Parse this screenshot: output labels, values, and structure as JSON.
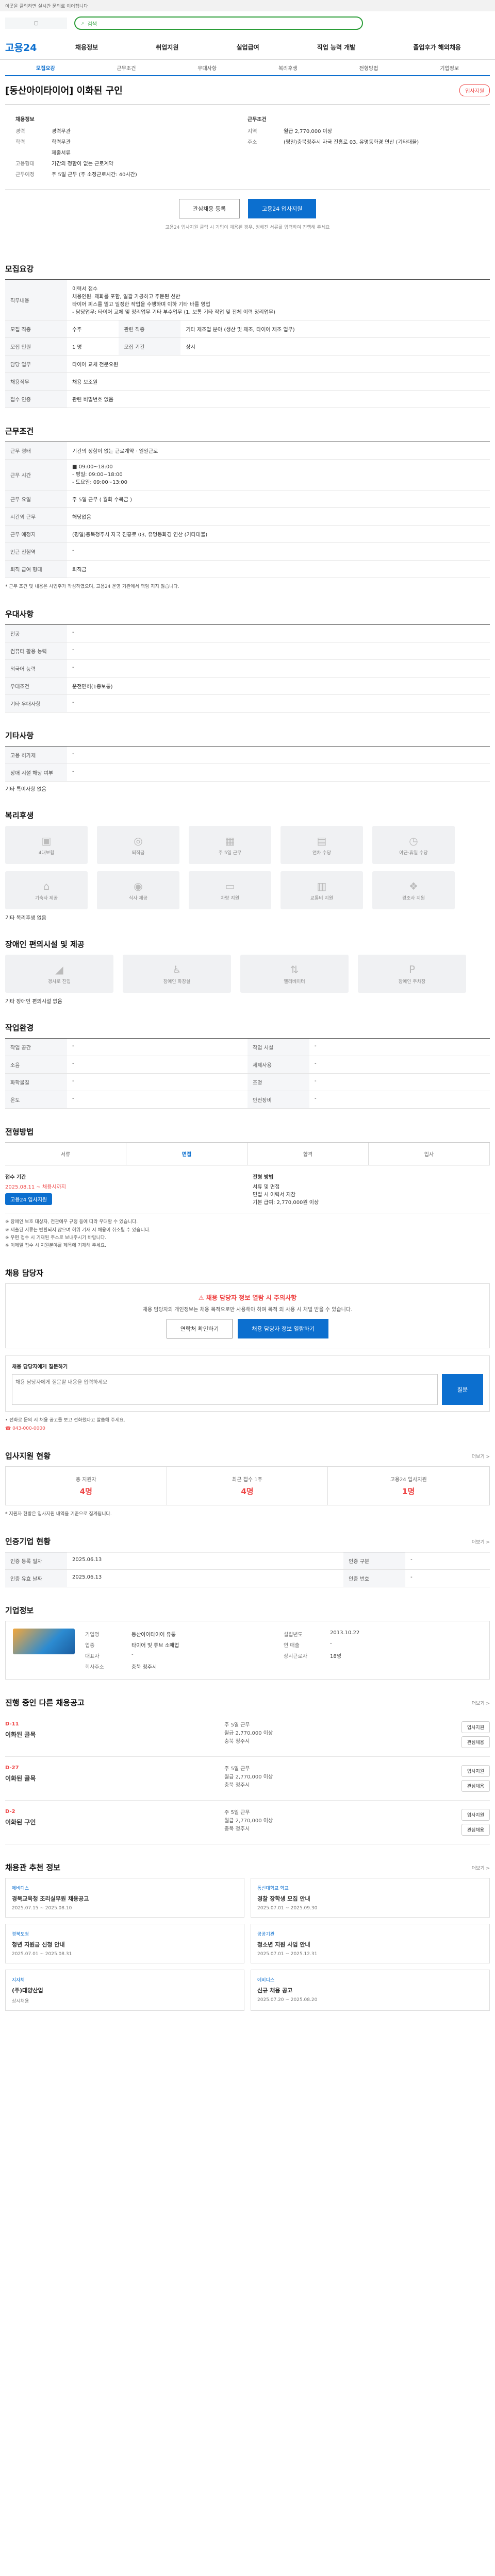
{
  "topbar": "이곳을 클릭하면 실시간 문의로 이어집니다",
  "search_placeholder": "검색",
  "gnb": {
    "brand": "고용24",
    "items": [
      "채용정보",
      "취업지원",
      "실업급여",
      "직업 능력 개발",
      "졸업후가 해외채용"
    ]
  },
  "subtabs": [
    "모집요강",
    "근무조건",
    "우대사항",
    "복리후생",
    "전형방법",
    "기업정보"
  ],
  "job": {
    "title": "[동산아이타이어] 이화된 구인",
    "enter": "입사지원",
    "summary_left": [
      [
        "경력",
        "경력무관"
      ],
      [
        "학력",
        "학력무관"
      ],
      [
        "",
        "제출서류"
      ],
      [
        "고용형태",
        "기간의 정함이 없는 근로계약"
      ],
      [
        "근무예정",
        "주 5일 근무 (주 소정근로시간: 40시간)"
      ]
    ],
    "summary_right": [
      [
        "지역",
        "월급 2,770,000 이상"
      ],
      [
        "주소",
        "(평일)충북청주시 자국 진흥로 03, 유명동화경 연산 (기타대불)"
      ]
    ],
    "summary_right_head": "근무조건",
    "apply_info_head": "채용정보"
  },
  "actions": {
    "interest": "관심채용 등록",
    "apply": "고용24 입사지원"
  },
  "actions_note": "고용24 입사지원 클릭 시 기업이 채용된 경우, 정해진 서류를 입력하여 진행해 주세요",
  "s1": {
    "title": "모집요강",
    "rows": [
      [
        "직무내용",
        "이력서 접수\n채용인원: 제화를 포함, 일괄 가공하고 주문된 선반\n타이어 피스를 밀고 일정한 작업을 수행하며 이하 기타 바를 영업\n- 담당업무: 타이어 교체 및 정리업무 기타 부수업무 (1. 보통 기타 작업 및 전체 이력 정리업무)"
      ],
      [
        "모집 직종",
        "수주"
      ],
      [
        "관련 직종",
        "기타 제조업 분야 (생산 및 제조, 타이어 제조 업무)"
      ],
      [
        "모집 인원",
        "1 명"
      ],
      [
        "모집 기간",
        "상시"
      ],
      [
        "담당 업무",
        "타이어 교체 전문요원"
      ],
      [
        "채용직무",
        "채용 보조원"
      ],
      [
        "접수 인증",
        "관련 비밀번호 없음"
      ]
    ]
  },
  "s2": {
    "title": "근무조건",
    "rows": [
      [
        "근무 형태",
        "기간의 정함이 없는 근로계약 · 일일근로"
      ],
      [
        "근무 시간",
        "■ 09:00~18:00\n- 평일: 09:00~18:00\n- 토요일: 09:00~13:00"
      ],
      [
        "근무 요일",
        "주 5일 근무 ( 월화 수목금 )"
      ],
      [
        "시간외 근무",
        "해당없음"
      ],
      [
        "근무 예정지",
        "(평일)충북청주시 자국 진흥로 03, 유명동화경 연산 (기타대불)"
      ],
      [
        "인근 전철역",
        "-"
      ],
      [
        "퇴직 급여 형태",
        "퇴직금"
      ]
    ]
  },
  "s2_note": "* 근무 조건 및 내용은 사업주가 작성하였으며, 고용24 운영 기관에서 책임 지지 않습니다.",
  "s3": {
    "title": "우대사항",
    "rows": [
      [
        "전공",
        "-"
      ],
      [
        "컴퓨터 활용 능력",
        "-"
      ],
      [
        "외국어 능력",
        "-"
      ],
      [
        "우대조건",
        "운전면허(1종보통)"
      ],
      [
        "기타 우대사항",
        "-"
      ]
    ]
  },
  "s4": {
    "title": "기타사항",
    "rows": [
      [
        "고용 허가제",
        "-"
      ],
      [
        "장애 시설 해당 여부",
        "-"
      ]
    ]
  },
  "s4_extra": "기타 특이사항 없음",
  "s5": {
    "title": "복리후생",
    "items": [
      "4대보험",
      "퇴직금",
      "주 5일 근무",
      "연차 수당",
      "야근·휴일 수당",
      "기숙사 제공",
      "식사 제공",
      "차량 지원",
      "교통비 지원",
      "경조사 지원"
    ]
  },
  "s5_extra": "기타 복리후생 없음",
  "s6": {
    "title": "장애인 편의시설 및 제공",
    "items": [
      "경사로 진입",
      "장애인 화장실",
      "엘리베이터",
      "장애인 주차장"
    ]
  },
  "s6_extra": "기타 장애인 편의시설 없음",
  "s7": {
    "title": "작업환경",
    "rows": [
      [
        "작업 공간",
        "-",
        "작업 시설",
        "-"
      ],
      [
        "소음",
        "-",
        "세제사용",
        "-"
      ],
      [
        "화학물질",
        "-",
        "조명",
        "-"
      ],
      [
        "온도",
        "-",
        "안전장비",
        "-"
      ]
    ]
  },
  "s8": {
    "title": "전형방법",
    "steps": [
      "서류",
      "면접",
      "합격",
      "입사"
    ],
    "a1_lbl": "접수 기간",
    "a1_val": "2025.08.11 ~ 채용시까지",
    "a1_btn": "고용24 입사지원",
    "a2_lbl": "전형 방법",
    "a2_val": "서류 및 면접\n면접 시 이력서 지참\n기본 급여: 2,770,000원 이상",
    "notes": [
      "※ 장애인 보호 대상자, 전관예우 규정 등에 따라 우대할 수 있습니다.",
      "※ 제출된 서류는 반환되지 않으며 허위 기재 시 채용이 취소될 수 있습니다.",
      "※ 우편 접수 시 기재된 주소로 보내주시기 바랍니다.",
      "※ 이메일 접수 시 지원분야를 제목에 기재해 주세요."
    ]
  },
  "s9": {
    "title": "채용 담당자",
    "warn": "채용 담당자 정보 열람 시 주의사항",
    "desc": "채용 담당자의 개인정보는 채용 목적으로만 사용해야 하며 목적 외 사용 시 처벌 받을 수 있습니다.",
    "b1": "연락처 확인하기",
    "b2": "채용 담당자 정보 열람하기",
    "q_label": "채용 담당자에게 질문하기",
    "q_placeholder": "채용 담당자에게 질문할 내용을 입력하세요",
    "q_btn": "질문",
    "phone": "☎ 043-000-0000",
    "contact_note": "• 전화로 문의 시 채용 공고를 보고 전화했다고 말씀해 주세요."
  },
  "s10": {
    "title": "입사지원 현황",
    "more": "더보기 >",
    "stats": [
      [
        "총 지원자",
        "4명"
      ],
      [
        "최근 접수 1주",
        "4명"
      ],
      [
        "고용24 입사지원",
        "1명"
      ]
    ],
    "note": "* 지원자 현황은 입사지원 내역을 기준으로 집계됩니다."
  },
  "s11": {
    "title": "인증기업 현황",
    "more": "더보기 >",
    "rows": [
      [
        "인증 등록 일자",
        "2025.06.13",
        "인증 구분",
        "-"
      ],
      [
        "인증 유효 날짜",
        "2025.06.13",
        "인증 번호",
        "-"
      ]
    ]
  },
  "s12": {
    "title": "기업정보",
    "rows": [
      [
        "기업명",
        "동산아이타이어 유통",
        "설립년도",
        "2013.10.22"
      ],
      [
        "업종",
        "타이어 및 튜브 소매업",
        "연 매출",
        "-"
      ],
      [
        "대표자",
        "-",
        "상시근로자",
        "18명"
      ],
      [
        "회사주소",
        "충북 청주시",
        "",
        ""
      ]
    ]
  },
  "s13": {
    "title": "진행 중인 다른 채용공고",
    "more": "더보기 >",
    "jobs": [
      {
        "d": "D-11",
        "t": "이화된 골목",
        "m": "주 5일 근무\n월급 2,770,000 이상\n충북 청주시",
        "b": [
          "입사지원",
          "관심채용"
        ]
      },
      {
        "d": "D-27",
        "t": "이화된 골목",
        "m": "주 5일 근무\n월급 2,770,000 이상\n충북 청주시",
        "b": [
          "입사지원",
          "관심채용"
        ]
      },
      {
        "d": "D-2",
        "t": "이화된 구인",
        "m": "주 5일 근무\n월급 2,770,000 이상\n충북 청주시",
        "b": [
          "입사지원",
          "관심채용"
        ]
      }
    ]
  },
  "s14": {
    "title": "채용관 추천 정보",
    "more": "더보기 >",
    "items": [
      {
        "c": "에비디스",
        "t": "경북교육청 조리실무원 채용공고",
        "m": "2025.07.15 ~ 2025.08.10"
      },
      {
        "c": "동신대학교 학교",
        "t": "경찰 장학생 모집 안내",
        "m": "2025.07.01 ~ 2025.09.30"
      },
      {
        "c": "경북도청",
        "t": "청년 지원금 신청 안내",
        "m": "2025.07.01 ~ 2025.08.31"
      },
      {
        "c": "공공기관",
        "t": "청소년 지원 사업 안내",
        "m": "2025.07.01 ~ 2025.12.31"
      },
      {
        "c": "지자체",
        "t": "(주)대양산업",
        "m": "상시채용"
      },
      {
        "c": "에비디스",
        "t": "신규 채용 공고",
        "m": "2025.07.20 ~ 2025.08.20"
      }
    ]
  }
}
